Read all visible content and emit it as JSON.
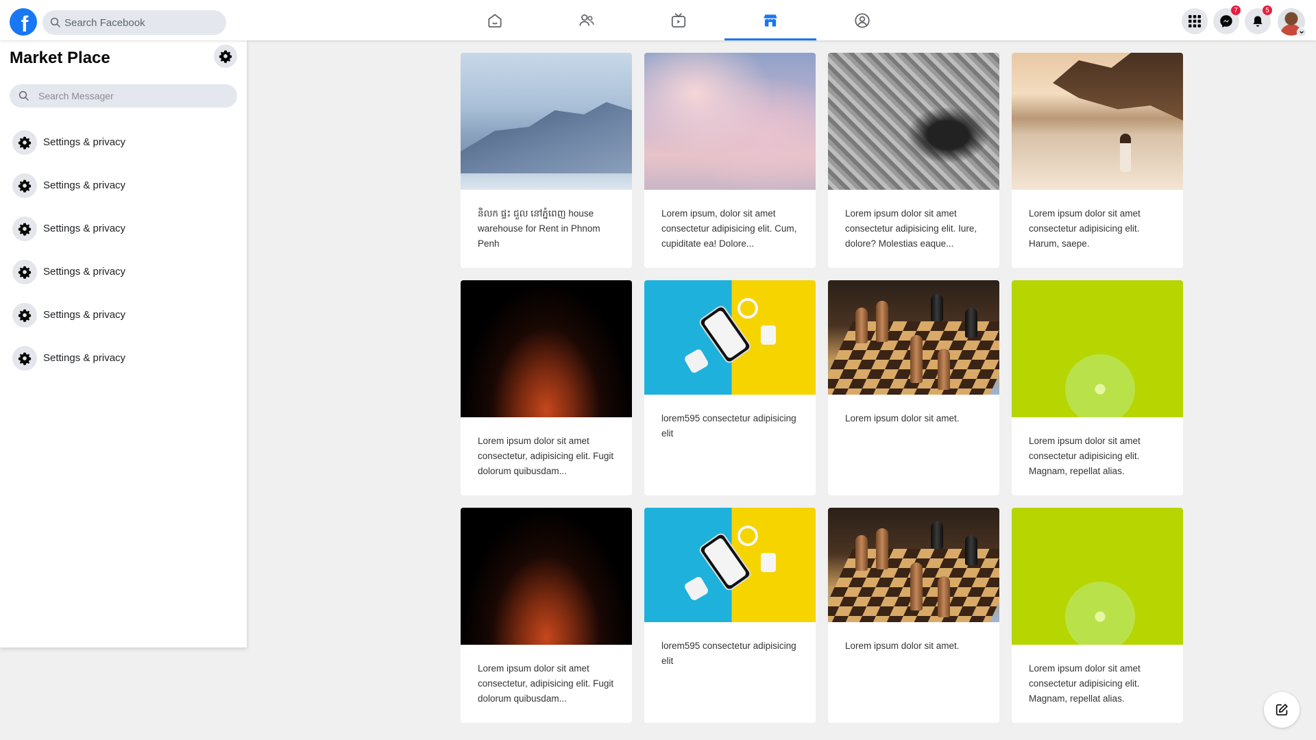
{
  "header": {
    "logo_letter": "f",
    "search_placeholder": "Search Facebook",
    "nav": [
      {
        "icon": "home-icon",
        "active": false
      },
      {
        "icon": "friends-icon",
        "active": false
      },
      {
        "icon": "watch-icon",
        "active": false
      },
      {
        "icon": "marketplace-icon",
        "active": true
      },
      {
        "icon": "profile-icon",
        "active": false
      }
    ],
    "messenger_badge": "7",
    "notifications_badge": "5"
  },
  "sidebar": {
    "title": "Market Place",
    "search_placeholder": "Search Messager",
    "items": [
      {
        "label": "Settings & privacy"
      },
      {
        "label": "Settings & privacy"
      },
      {
        "label": "Settings & privacy"
      },
      {
        "label": "Settings & privacy"
      },
      {
        "label": "Settings & privacy"
      },
      {
        "label": "Settings & privacy"
      }
    ]
  },
  "listings": [
    {
      "image": "mountain-lake",
      "text": "និលក ផ្ទះ ជួល នៅភ្នំពេញ house warehouse for Rent in Phnom Penh"
    },
    {
      "image": "pink-sky",
      "text": "Lorem ipsum, dolor sit amet consectetur adipisicing elit. Cum, cupiditate ea! Dolore..."
    },
    {
      "image": "bw-car-interior",
      "text": "Lorem ipsum dolor sit amet consectetur adipisicing elit. Iure, dolore? Molestias eaque..."
    },
    {
      "image": "beach-woman",
      "text": "Lorem ipsum dolor sit amet consectetur adipisicing elit. Harum, saepe."
    },
    {
      "image": "fire-dark",
      "text": "Lorem ipsum dolor sit amet consectetur, adipisicing elit. Fugit dolorum quibusdam..."
    },
    {
      "image": "phone-accessories",
      "text": "lorem595 consectetur adipisicing elit"
    },
    {
      "image": "chess-board",
      "text": "Lorem ipsum dolor sit amet."
    },
    {
      "image": "lime-slice",
      "text": "Lorem ipsum dolor sit amet consectetur adipisicing elit. Magnam, repellat alias."
    },
    {
      "image": "fire-dark",
      "text": "Lorem ipsum dolor sit amet consectetur, adipisicing elit. Fugit dolorum quibusdam..."
    },
    {
      "image": "phone-accessories",
      "text": "lorem595 consectetur adipisicing elit"
    },
    {
      "image": "chess-board",
      "text": "Lorem ipsum dolor sit amet."
    },
    {
      "image": "lime-slice",
      "text": "Lorem ipsum dolor sit amet consectetur adipisicing elit. Magnam, repellat alias."
    }
  ],
  "colors": {
    "accent": "#1877f2",
    "badge": "#e41e3f",
    "page_bg": "#f0f0f0"
  }
}
